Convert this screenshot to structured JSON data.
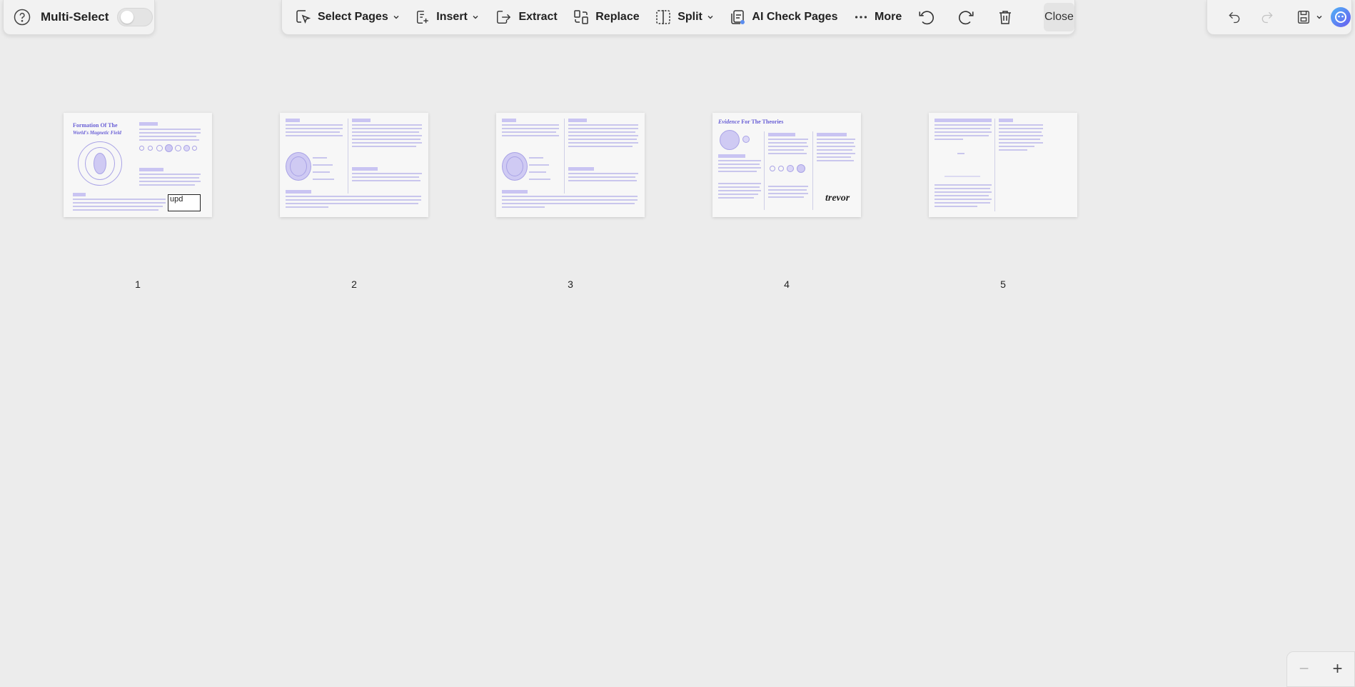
{
  "left_panel": {
    "help_icon": "help-circle-icon",
    "multi_select_label": "Multi-Select",
    "multi_select_enabled": false
  },
  "toolbar": {
    "select_pages": "Select Pages",
    "insert": "Insert",
    "extract": "Extract",
    "replace": "Replace",
    "split": "Split",
    "ai_check_pages": "AI Check Pages",
    "more": "More",
    "close": "Close"
  },
  "right_panel": {
    "undo_icon": "undo-icon",
    "redo_icon": "redo-icon",
    "save_icon": "save-icon",
    "ai_assistant_icon": "ai-assistant-icon"
  },
  "pages": [
    {
      "number": "1",
      "heading_a": "Formation Of The",
      "heading_b": "World's Magnetic Field",
      "stamp": "upd"
    },
    {
      "number": "2"
    },
    {
      "number": "3"
    },
    {
      "number": "4",
      "heading_a": "Evidence",
      "heading_b": "For The Theories",
      "signature": "trevor"
    },
    {
      "number": "5"
    }
  ],
  "zoom": {
    "zoom_out": "−",
    "zoom_in": "+"
  },
  "colors": {
    "accent": "#6a60d6",
    "background": "#ececec"
  }
}
